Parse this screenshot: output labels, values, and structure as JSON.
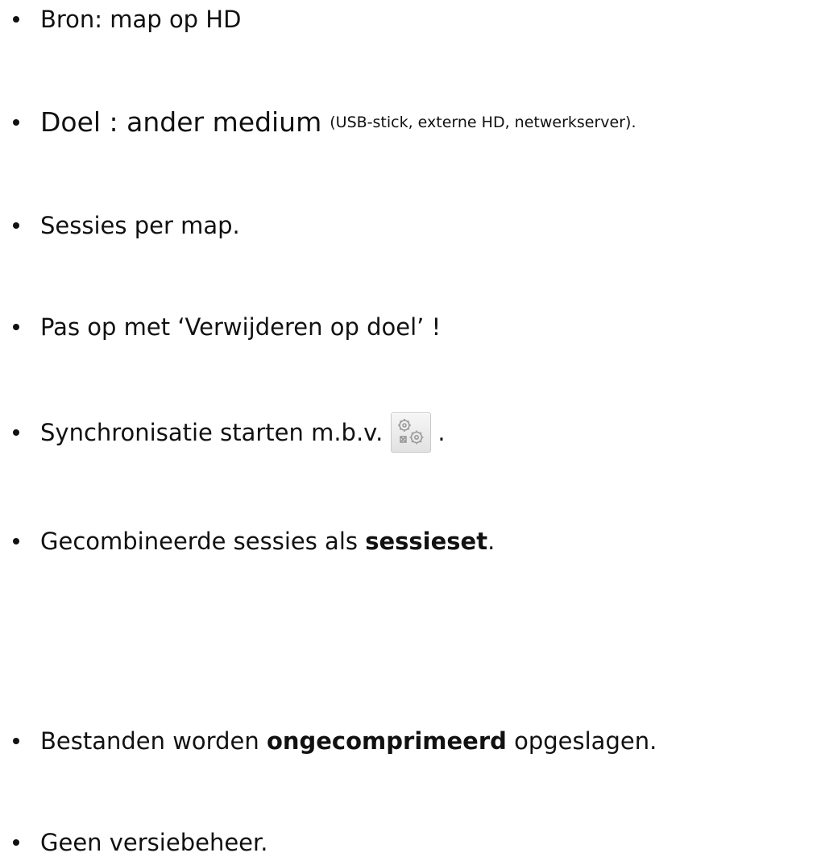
{
  "bullets": [
    {
      "text": "Bron: map op HD"
    },
    {
      "main": "Doel : ander medium",
      "note": "(USB-stick, externe HD, netwerkserver)."
    },
    {
      "text": "Sessies per map."
    },
    {
      "text": "Pas op met ‘Verwijderen op doel’ !"
    },
    {
      "before": "Synchronisatie starten m.b.v.",
      "after": ".",
      "icon": "gears-icon"
    },
    {
      "before": "Gecombineerde sessies als ",
      "bold": "sessieset",
      "after": "."
    },
    {
      "before": "Bestanden worden ",
      "bold": "ongecomprimeerd",
      "after": " opgeslagen."
    },
    {
      "text": "Geen versiebeheer."
    }
  ]
}
